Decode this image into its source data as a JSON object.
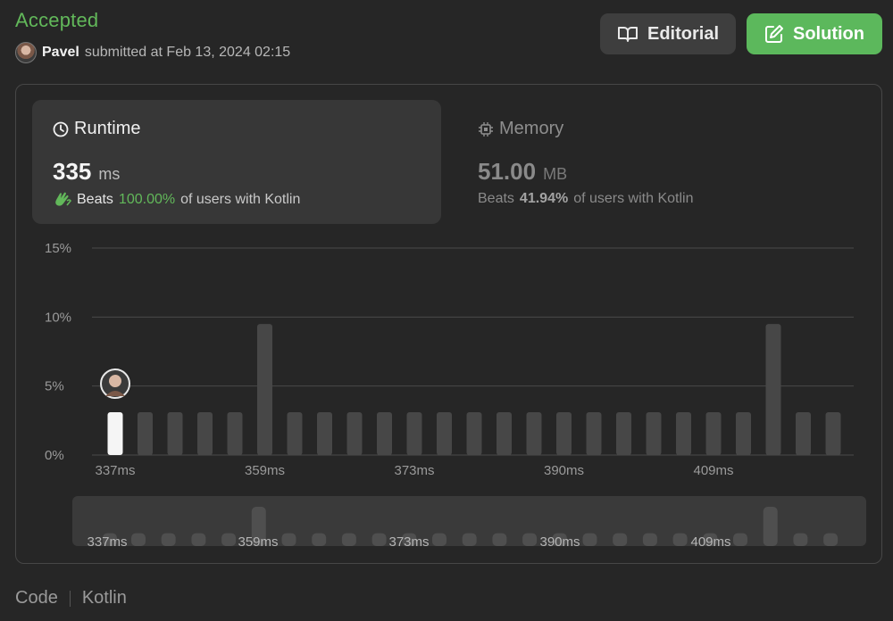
{
  "status": "Accepted",
  "submitter": {
    "name": "Pavel",
    "submitted_text": "submitted at Feb 13, 2024 02:15"
  },
  "buttons": {
    "editorial": "Editorial",
    "solution": "Solution"
  },
  "runtime": {
    "title": "Runtime",
    "value": "335",
    "unit": "ms",
    "beats_label": "Beats",
    "beats_pct": "100.00%",
    "beats_suffix": "of users with Kotlin"
  },
  "memory": {
    "title": "Memory",
    "value": "51.00",
    "unit": "MB",
    "beats_label": "Beats",
    "beats_pct": "41.94%",
    "beats_suffix": "of users with Kotlin"
  },
  "footer": {
    "code_label": "Code",
    "language": "Kotlin"
  },
  "colors": {
    "accent_green": "#5cb85c",
    "highlight_bar": "#f5f5f5",
    "bar": "#474747"
  },
  "chart_data": {
    "type": "bar",
    "ylabel_ticks": [
      "0%",
      "5%",
      "10%",
      "15%"
    ],
    "ylim": [
      0,
      15
    ],
    "x_tick_labels": [
      "337ms",
      "359ms",
      "373ms",
      "390ms",
      "409ms"
    ],
    "values": [
      3.1,
      3.1,
      3.1,
      3.1,
      3.1,
      9.5,
      3.1,
      3.1,
      3.1,
      3.1,
      3.1,
      3.1,
      3.1,
      3.1,
      3.1,
      3.1,
      3.1,
      3.1,
      3.1,
      3.1,
      3.1,
      3.1,
      9.5,
      3.1,
      3.1
    ],
    "highlight_index": 0,
    "grid": true
  }
}
